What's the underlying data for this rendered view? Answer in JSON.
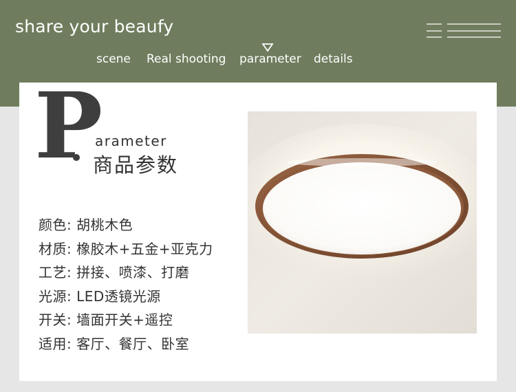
{
  "header": {
    "brand": "share your beaufy",
    "nav": [
      "scene",
      "Real shooting",
      "parameter",
      "details"
    ],
    "active_index": 2
  },
  "section": {
    "initial": "P",
    "english_rest": "arameter",
    "chinese_title": "商品参数"
  },
  "specs": [
    "颜色: 胡桃木色",
    "材质: 橡胶木+五金+亚克力",
    "工艺: 拼接、喷漆、打磨",
    "光源: LED透镜光源",
    "开关: 墙面开关+遥控",
    "适用: 客厅、餐厅、卧室"
  ],
  "colors": {
    "header_bg": "#6f7d5e",
    "page_bg": "#e6e6e6",
    "card_bg": "#ffffff",
    "text": "#333333",
    "walnut": "#8a5a3c"
  },
  "image": {
    "subject": "round-ceiling-lamp-walnut-frame"
  }
}
